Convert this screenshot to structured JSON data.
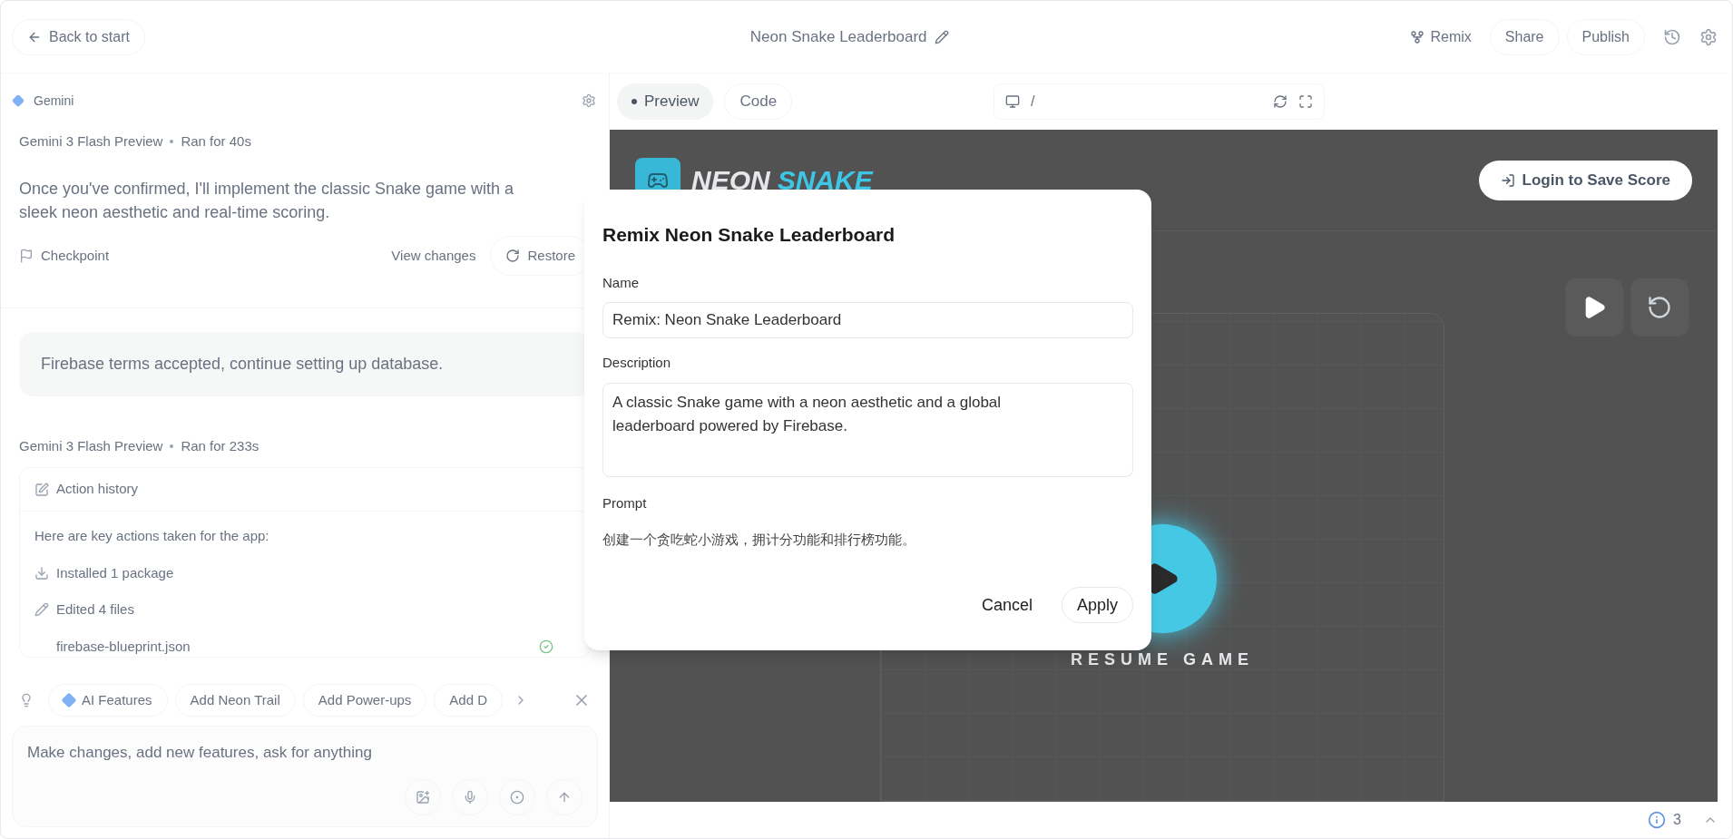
{
  "top_bar": {
    "back_button": "Back to start",
    "title": "Neon Snake Leaderboard",
    "actions": [
      {
        "kind": "icon_text",
        "label": "Remix"
      },
      {
        "kind": "outlined",
        "label": "Share"
      },
      {
        "kind": "outlined",
        "label": "Publish"
      }
    ]
  },
  "chat_panel": {
    "header": "Gemini",
    "first_reply": {
      "model": "Gemini 3 Flash Preview",
      "duration": "Ran for 40s",
      "text": "Once you've confirmed, I'll implement the classic Snake game with a sleek neon aesthetic and real-time scoring.",
      "checkpoint": "Checkpoint",
      "view_changes": "View changes",
      "restore": "Restore"
    },
    "user_message": "Firebase terms accepted, continue setting up database.",
    "second_reply": {
      "model": "Gemini 3 Flash Preview",
      "duration": "Ran for 233s",
      "action_history": {
        "title": "Action history",
        "intro": "Here are key actions taken for the app:",
        "items": [
          {
            "kind": "install",
            "label": "Installed 1 package"
          },
          {
            "kind": "edit",
            "label": "Edited 4 files"
          },
          {
            "kind": "file",
            "label": "firebase-blueprint.json"
          }
        ]
      }
    },
    "suggestions": [
      {
        "kind": "ai",
        "label": "AI Features"
      },
      {
        "kind": "plain",
        "label": "Add Neon Trail"
      },
      {
        "kind": "plain",
        "label": "Add Power-ups"
      },
      {
        "kind": "plain",
        "label": "Add D"
      }
    ],
    "input": {
      "placeholder": "Make changes, add new features, ask for anything"
    }
  },
  "preview_panel": {
    "tabs": [
      {
        "label": "Preview",
        "selected": true
      },
      {
        "label": "Code",
        "selected": false
      }
    ],
    "address": "/",
    "game": {
      "logo_first": "NEON",
      "logo_second": "SNAKE",
      "login_button": "Login to Save Score",
      "overlay_label": "RESUME GAME"
    },
    "status": {
      "issues": "3"
    }
  },
  "dialog": {
    "title": "Remix Neon Snake Leaderboard",
    "name_label": "Name",
    "name_value": "Remix: Neon Snake Leaderboard",
    "description_label": "Description",
    "description_value": "A classic Snake game with a neon aesthetic and a global leaderboard powered by Firebase.",
    "prompt_label": "Prompt",
    "prompt_text": "创建一个贪吃蛇小游戏，拥计分功能和排行榜功能。",
    "cancel": "Cancel",
    "apply": "Apply"
  }
}
